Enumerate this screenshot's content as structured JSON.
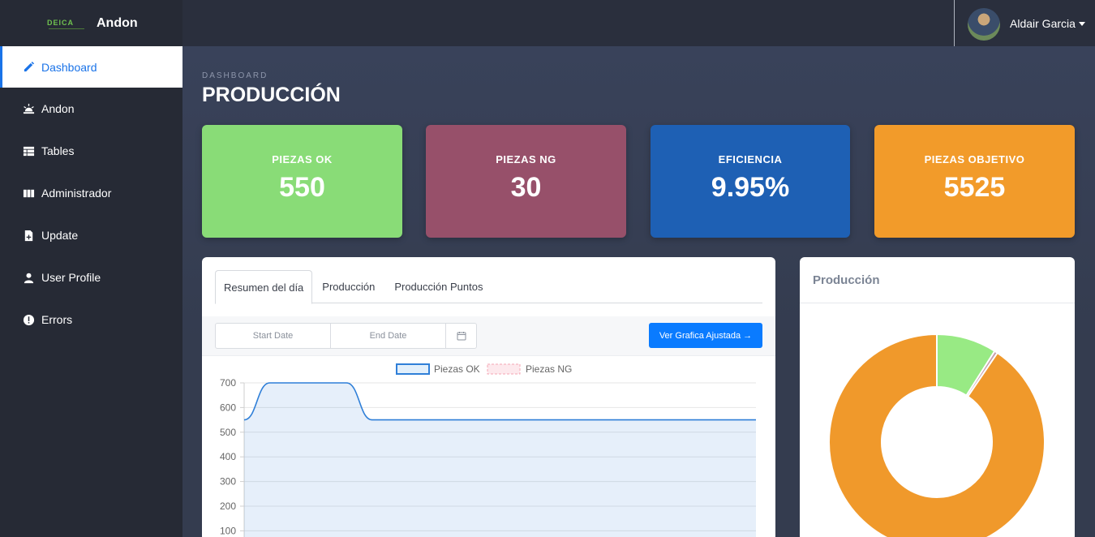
{
  "sidebar": {
    "logo_text": "DEICA",
    "brand": "Andon",
    "items": [
      {
        "label": "Dashboard",
        "icon": "pencil-icon"
      },
      {
        "label": "Andon",
        "icon": "alarm-icon"
      },
      {
        "label": "Tables",
        "icon": "table-icon"
      },
      {
        "label": "Administrador",
        "icon": "columns-icon"
      },
      {
        "label": "Update",
        "icon": "file-plus-icon"
      },
      {
        "label": "User Profile",
        "icon": "user-icon"
      },
      {
        "label": "Errors",
        "icon": "error-icon"
      }
    ],
    "active_item": "Dashboard"
  },
  "topbar": {
    "user_name": "Aldair Garcia"
  },
  "header": {
    "kicker": "DASHBOARD",
    "title": "PRODUCCIÓN"
  },
  "stats": [
    {
      "label": "PIEZAS OK",
      "value": "550",
      "color": "#89dc77"
    },
    {
      "label": "PIEZAS NG",
      "value": "30",
      "color": "#97506a"
    },
    {
      "label": "EFICIENCIA",
      "value": "9.95%",
      "color": "#1e60b4"
    },
    {
      "label": "PIEZAS OBJETIVO",
      "value": "5525",
      "color": "#f29b2a"
    }
  ],
  "chart_panel": {
    "tabs": [
      "Resumen del día",
      "Producción",
      "Producción Puntos"
    ],
    "active_tab": "Resumen del día",
    "start_placeholder": "Start Date",
    "end_placeholder": "End Date",
    "adjust_button": "Ver Grafica Ajustada →"
  },
  "donut_panel": {
    "title": "Producción"
  },
  "chart_data": [
    {
      "type": "area",
      "series": [
        {
          "name": "Piezas OK",
          "color": "#2f7fd8",
          "values": [
            550,
            700,
            700,
            700,
            700,
            550,
            550,
            550,
            550,
            550,
            550,
            550,
            550,
            550,
            550,
            550,
            550,
            550,
            550,
            550,
            550
          ]
        },
        {
          "name": "Piezas NG",
          "color": "#f4a6b4",
          "values": []
        }
      ],
      "yticks": [
        700,
        600,
        500,
        400,
        300,
        200,
        100
      ],
      "ylim": [
        100,
        700
      ],
      "legend": "top",
      "grid": true
    },
    {
      "type": "pie",
      "hole": true,
      "slices": [
        {
          "label": "Piezas OK",
          "value": 550,
          "color": "#98ea84"
        },
        {
          "label": "Piezas NG",
          "value": 30,
          "color": "#c7a0aa"
        },
        {
          "label": "Piezas Objetivo",
          "value": 5525,
          "color": "#f0992b"
        }
      ]
    }
  ]
}
